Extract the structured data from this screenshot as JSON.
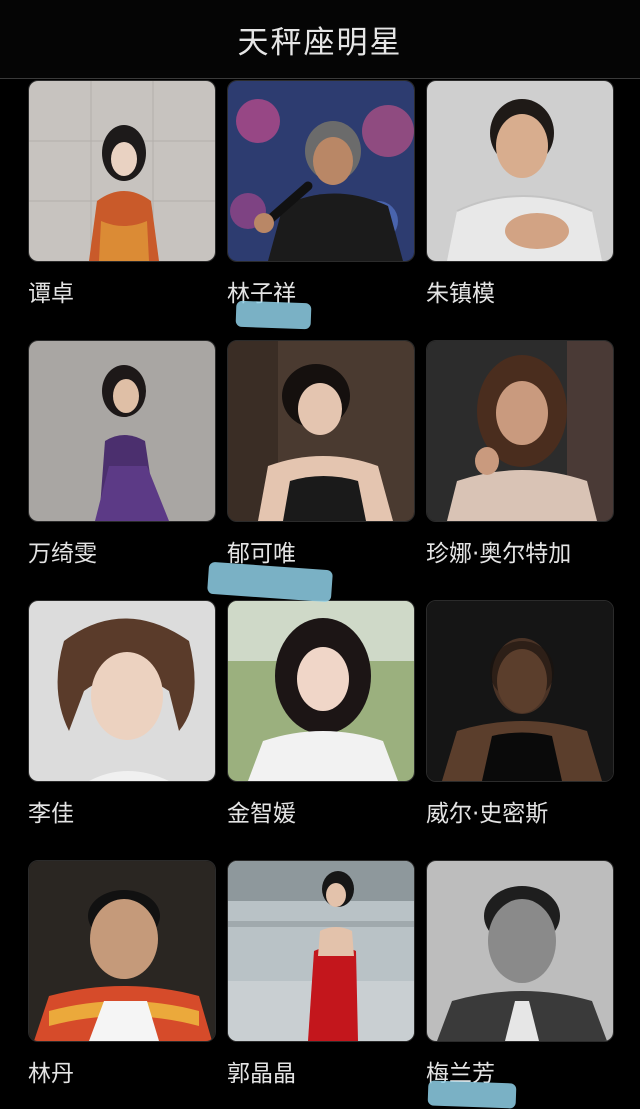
{
  "header": {
    "title": "天秤座明星"
  },
  "celebrities": [
    {
      "name": "谭卓",
      "photo_icon": "person-portrait-icon",
      "bg": "#c7c3bf",
      "figure": "#c95a2a"
    },
    {
      "name": "林子祥",
      "photo_icon": "person-portrait-icon",
      "bg": "#2d3c70",
      "figure": "#1b1b1b"
    },
    {
      "name": "朱镇模",
      "photo_icon": "person-portrait-icon",
      "bg": "#cfcfcf",
      "figure": "#e8e8e8"
    },
    {
      "name": "万绮雯",
      "photo_icon": "person-portrait-icon",
      "bg": "#a9a6a3",
      "figure": "#4b2f6e"
    },
    {
      "name": "郁可唯",
      "photo_icon": "person-portrait-icon",
      "bg": "#4a3a30",
      "figure": "#1a1a1a"
    },
    {
      "name": "珍娜·奥尔特加",
      "photo_icon": "person-portrait-icon",
      "bg": "#2c2c2c",
      "figure": "#d9c3b5"
    },
    {
      "name": "李佳",
      "photo_icon": "person-portrait-icon",
      "bg": "#dcdcdc",
      "figure": "#5a3b2a"
    },
    {
      "name": "金智媛",
      "photo_icon": "person-portrait-icon",
      "bg": "#9bb07e",
      "figure": "#f2f2f2"
    },
    {
      "name": "威尔·史密斯",
      "photo_icon": "person-portrait-icon",
      "bg": "#151515",
      "figure": "#0a0a0a"
    },
    {
      "name": "林丹",
      "photo_icon": "person-portrait-icon",
      "bg": "#2a2622",
      "figure": "#d64b2a"
    },
    {
      "name": "郭晶晶",
      "photo_icon": "person-portrait-icon",
      "bg": "#b9c2c6",
      "figure": "#c3161c"
    },
    {
      "name": "梅兰芳",
      "photo_icon": "person-portrait-icon",
      "bg": "#bdbdbd",
      "figure": "#3a3a3a"
    }
  ],
  "colors": {
    "background": "#000000",
    "text": "#e4e4e4",
    "smudge": "#8fd0e8"
  }
}
